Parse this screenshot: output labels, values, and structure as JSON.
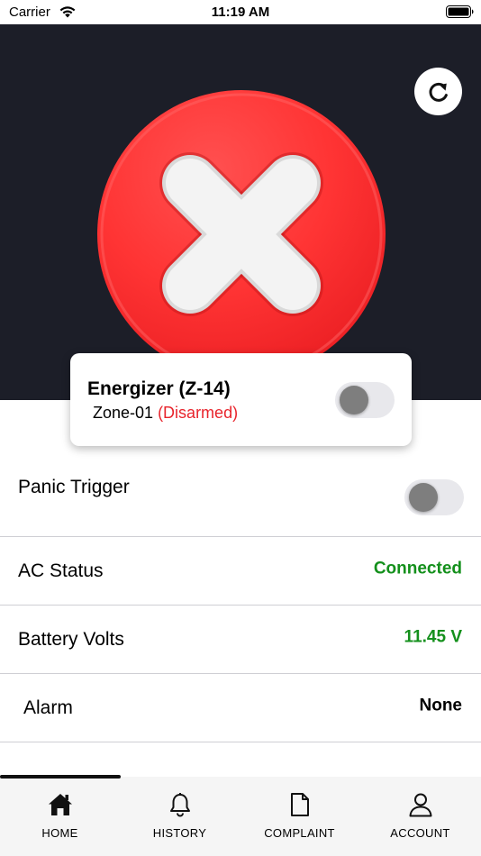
{
  "status_bar": {
    "carrier": "Carrier",
    "time": "11:19 AM"
  },
  "device": {
    "name": "Energizer (Z-14)",
    "zone": "Zone-01",
    "state": "(Disarmed)",
    "armed": false
  },
  "rows": {
    "panic": {
      "label": "Panic Trigger",
      "on": false
    },
    "ac": {
      "label": "AC Status",
      "value": "Connected"
    },
    "battery": {
      "label": "Battery Volts",
      "value": "11.45 V"
    },
    "alarm": {
      "label": "Alarm",
      "value": "None"
    }
  },
  "tabs": [
    {
      "label": "HOME",
      "icon": "home-icon",
      "active": true
    },
    {
      "label": "HISTORY",
      "icon": "bell-icon"
    },
    {
      "label": "COMPLAINT",
      "icon": "document-icon"
    },
    {
      "label": "ACCOUNT",
      "icon": "user-icon"
    }
  ],
  "colors": {
    "hero_bg": "#1c1e28",
    "disarmed": "#e8242c",
    "value_green": "#14901c",
    "alarm_value": "#000000"
  }
}
